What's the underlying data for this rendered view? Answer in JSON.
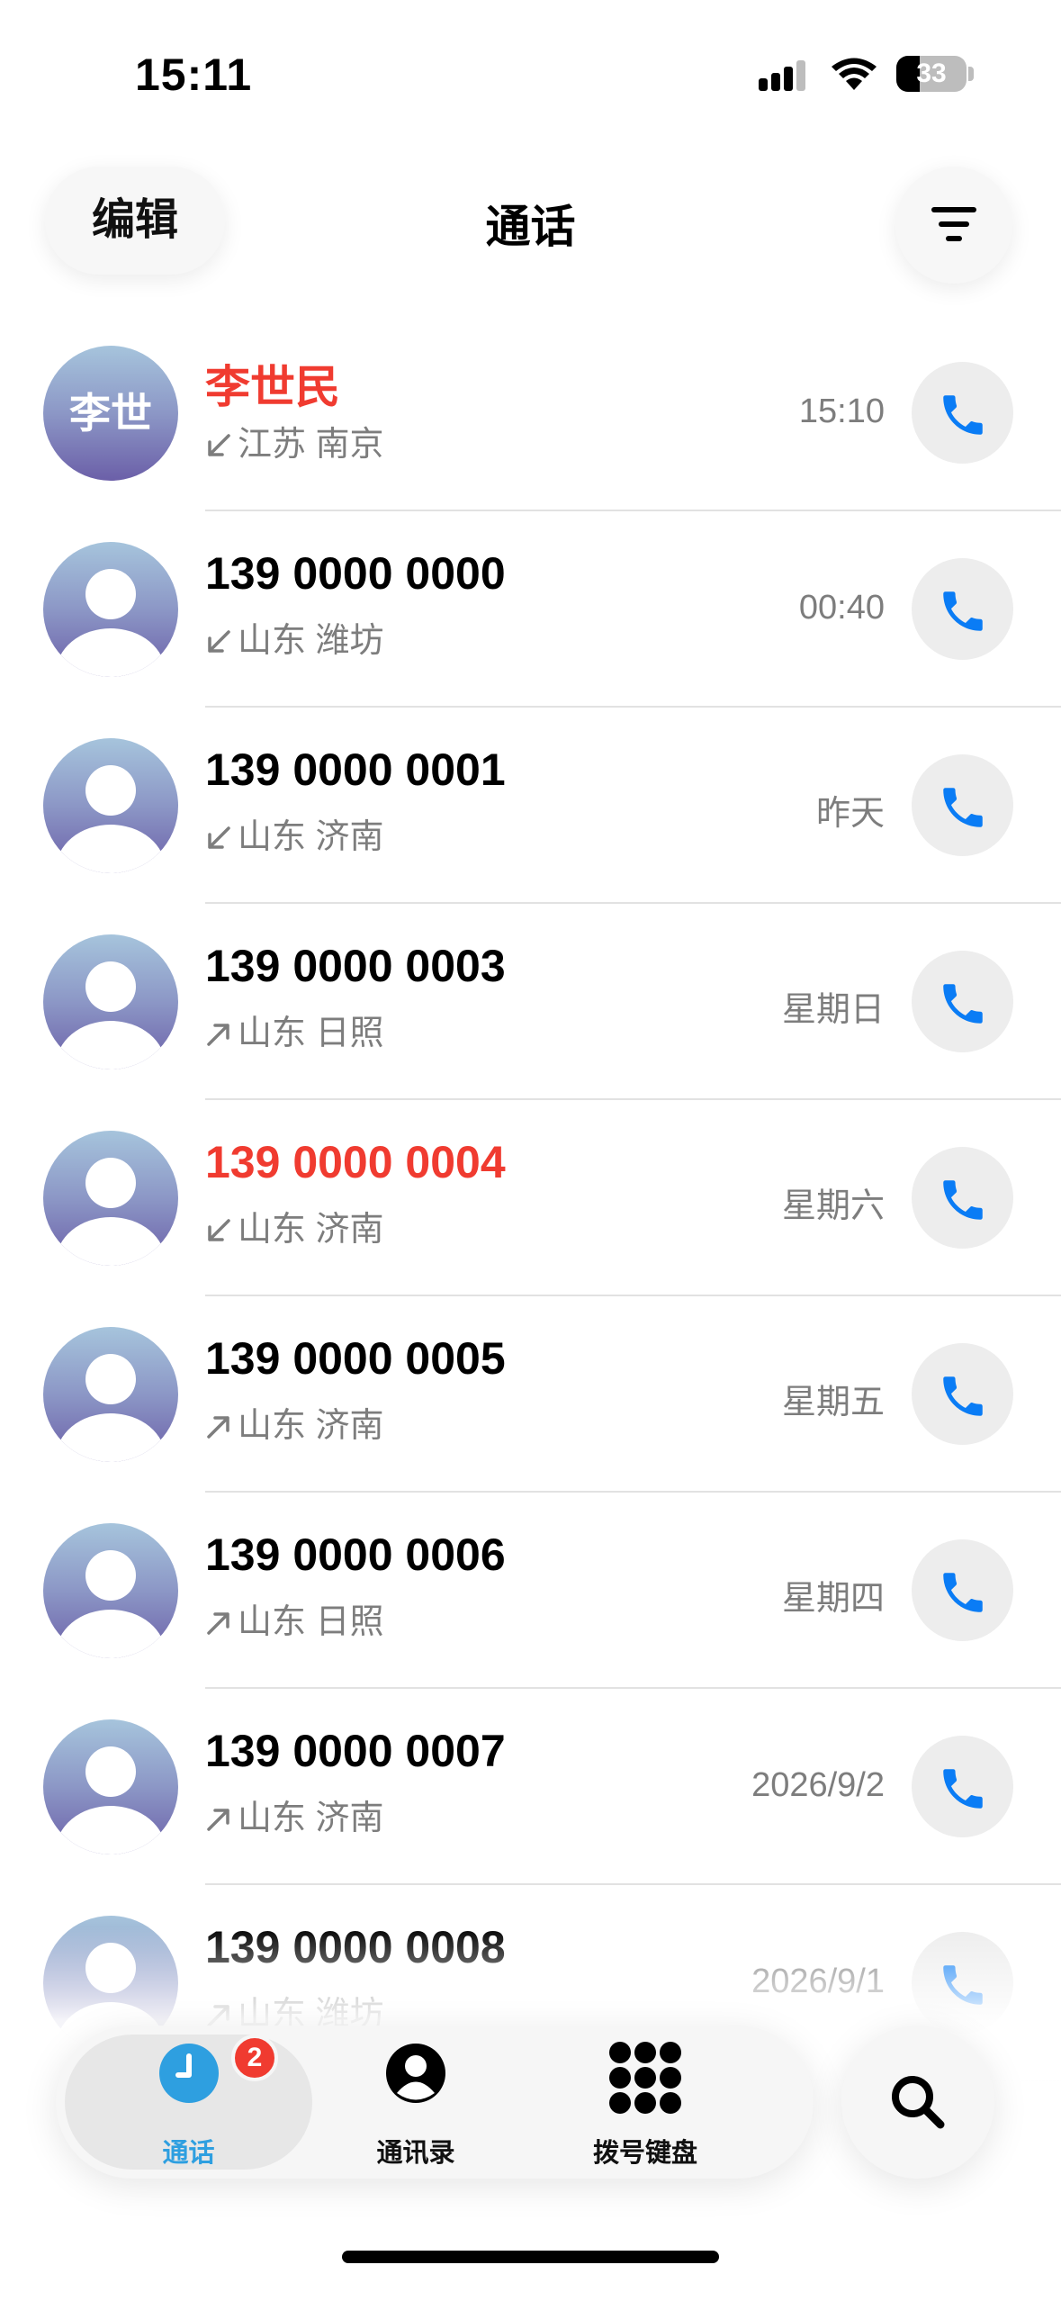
{
  "status_bar": {
    "time": "15:11",
    "battery": "33",
    "battery_level": 0.33
  },
  "header": {
    "edit_label": "编辑",
    "title": "通话",
    "filter_icon": "filter-lines-icon"
  },
  "colors": {
    "accent": "#0a7cf5",
    "missed": "#f03b30",
    "secondary_text": "#7d7d7d",
    "tab_active": "#2e9fe0"
  },
  "calls": [
    {
      "name": "李世民",
      "avatar_text": "李世",
      "direction": "incoming",
      "location": "江苏 南京",
      "time": "15:10",
      "missed": true
    },
    {
      "name": "139 0000 0000",
      "avatar_text": "",
      "direction": "incoming",
      "location": "山东 潍坊",
      "time": "00:40",
      "missed": false
    },
    {
      "name": "139 0000 0001",
      "avatar_text": "",
      "direction": "incoming",
      "location": "山东 济南",
      "time": "昨天",
      "missed": false
    },
    {
      "name": "139 0000 0003",
      "avatar_text": "",
      "direction": "outgoing",
      "location": "山东 日照",
      "time": "星期日",
      "missed": false
    },
    {
      "name": "139 0000 0004",
      "avatar_text": "",
      "direction": "incoming",
      "location": "山东 济南",
      "time": "星期六",
      "missed": true
    },
    {
      "name": "139 0000 0005",
      "avatar_text": "",
      "direction": "outgoing",
      "location": "山东 济南",
      "time": "星期五",
      "missed": false
    },
    {
      "name": "139 0000 0006",
      "avatar_text": "",
      "direction": "outgoing",
      "location": "山东 日照",
      "time": "星期四",
      "missed": false
    },
    {
      "name": "139 0000 0007",
      "avatar_text": "",
      "direction": "outgoing",
      "location": "山东 济南",
      "time": "2026/9/2",
      "missed": false
    },
    {
      "name": "139 0000 0008",
      "avatar_text": "",
      "direction": "outgoing",
      "location": "山东 潍坊",
      "time": "2026/9/1",
      "missed": false
    }
  ],
  "tabbar": {
    "tabs": [
      {
        "label": "通话",
        "icon": "clock-icon",
        "badge": "2",
        "active": true
      },
      {
        "label": "通讯录",
        "icon": "person-circle-icon",
        "badge": "",
        "active": false
      },
      {
        "label": "拨号键盘",
        "icon": "keypad-icon",
        "badge": "",
        "active": false
      }
    ],
    "search_icon": "search-icon"
  }
}
